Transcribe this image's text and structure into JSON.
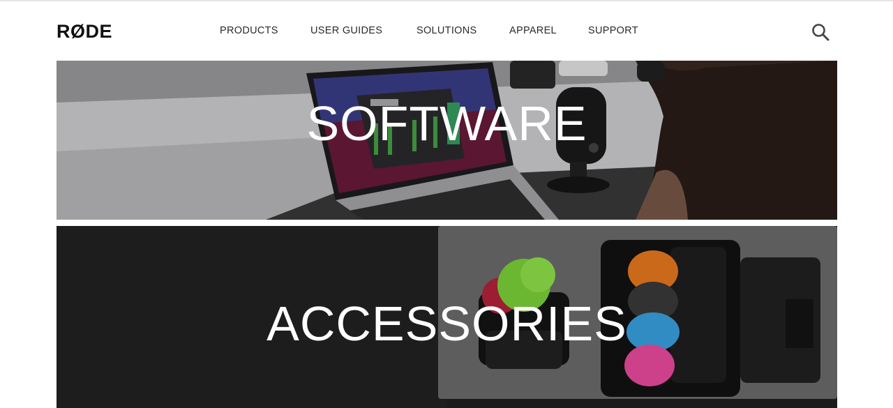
{
  "brand": {
    "logo_text": "RØDE"
  },
  "nav": {
    "items": [
      {
        "label": "PRODUCTS"
      },
      {
        "label": "USER GUIDES"
      },
      {
        "label": "SOLUTIONS"
      },
      {
        "label": "APPAREL"
      },
      {
        "label": "SUPPORT"
      }
    ],
    "search_icon": "search-icon"
  },
  "banners": [
    {
      "title": "SOFTWARE",
      "image": "laptop-with-podcast-software-and-microphone"
    },
    {
      "title": "ACCESSORIES",
      "image": "camera-bag-with-colorful-windshields"
    }
  ],
  "colors": {
    "text": "#2a2a2a",
    "logo": "#111111",
    "banner_title": "#ffffff"
  }
}
